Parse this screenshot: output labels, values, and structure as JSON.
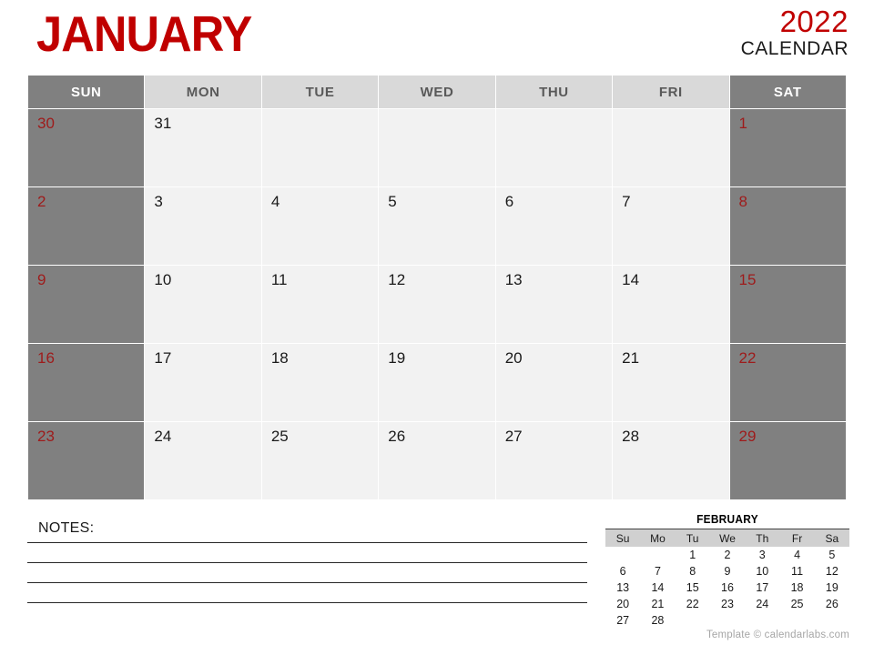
{
  "header": {
    "month": "JANUARY",
    "year": "2022",
    "calendar_word": "CALENDAR",
    "accent_color": "#c00000",
    "weekend_bg": "#808080",
    "weekday_head_bg": "#d9d9d9",
    "cell_bg": "#f2f2f2"
  },
  "calendar": {
    "day_headers": [
      "SUN",
      "MON",
      "TUE",
      "WED",
      "THU",
      "FRI",
      "SAT"
    ],
    "weeks": [
      [
        "30",
        "31",
        "",
        "",
        "",
        "",
        "1"
      ],
      [
        "2",
        "3",
        "4",
        "5",
        "6",
        "7",
        "8"
      ],
      [
        "9",
        "10",
        "11",
        "12",
        "13",
        "14",
        "15"
      ],
      [
        "16",
        "17",
        "18",
        "19",
        "20",
        "21",
        "22"
      ],
      [
        "23",
        "24",
        "25",
        "26",
        "27",
        "28",
        "29"
      ]
    ]
  },
  "notes": {
    "label": "NOTES:",
    "line_count": 4
  },
  "mini_calendar": {
    "title": "FEBRUARY",
    "day_headers": [
      "Su",
      "Mo",
      "Tu",
      "We",
      "Th",
      "Fr",
      "Sa"
    ],
    "weeks": [
      [
        "",
        "",
        "1",
        "2",
        "3",
        "4",
        "5"
      ],
      [
        "6",
        "7",
        "8",
        "9",
        "10",
        "11",
        "12"
      ],
      [
        "13",
        "14",
        "15",
        "16",
        "17",
        "18",
        "19"
      ],
      [
        "20",
        "21",
        "22",
        "23",
        "24",
        "25",
        "26"
      ],
      [
        "27",
        "28",
        "",
        "",
        "",
        "",
        ""
      ]
    ]
  },
  "footer": {
    "credit": "Template © calendarlabs.com"
  }
}
